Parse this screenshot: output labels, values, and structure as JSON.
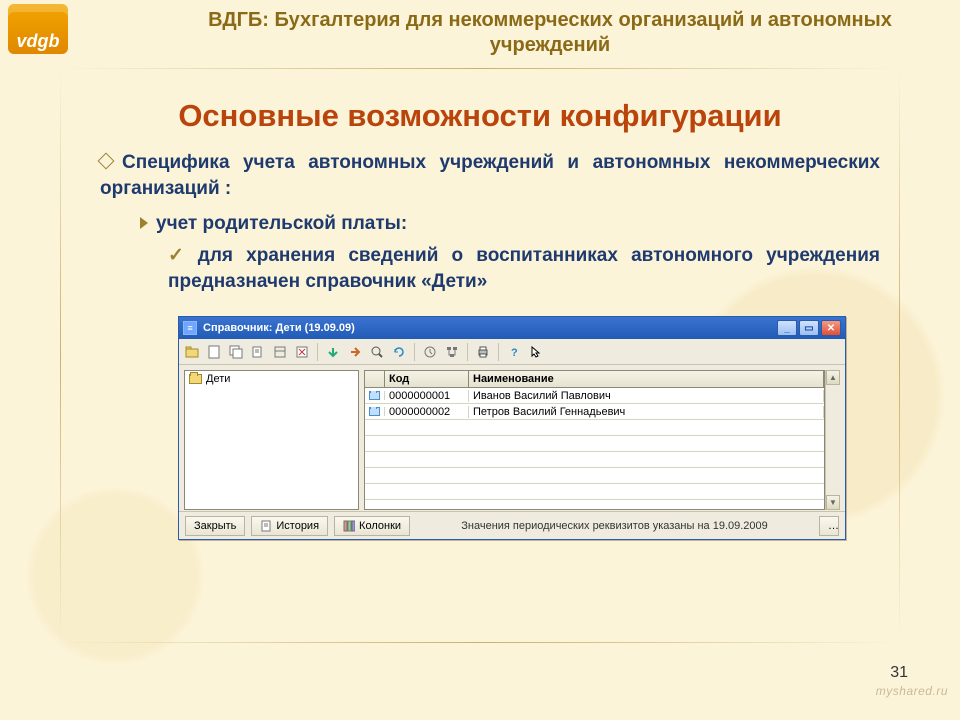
{
  "slide": {
    "logo_text": "vdgb",
    "header": "ВДГБ: Бухгалтерия для некоммерческих организаций и автономных учреждений",
    "title": "Основные возможности конфигурации",
    "para1": "Специфика учета автономных учреждений и автономных некоммерческих организаций :",
    "para2": "учет родительской платы:",
    "para3": "для хранения сведений о воспитанниках автономного учреждения предназначен справочник «Дети»",
    "page_number": "31",
    "watermark": "myshared.ru"
  },
  "window": {
    "title": "Справочник: Дети (19.09.09)",
    "tree_root": "Дети",
    "columns": {
      "code": "Код",
      "name": "Наименование"
    },
    "rows": [
      {
        "code": "0000000001",
        "name": "Иванов Василий Павлович"
      },
      {
        "code": "0000000002",
        "name": "Петров Василий Геннадьевич"
      }
    ],
    "buttons": {
      "close": "Закрыть",
      "history": "История",
      "columns": "Колонки"
    },
    "status_text": "Значения периодических реквизитов указаны на 19.09.2009",
    "ellipsis": "…"
  }
}
